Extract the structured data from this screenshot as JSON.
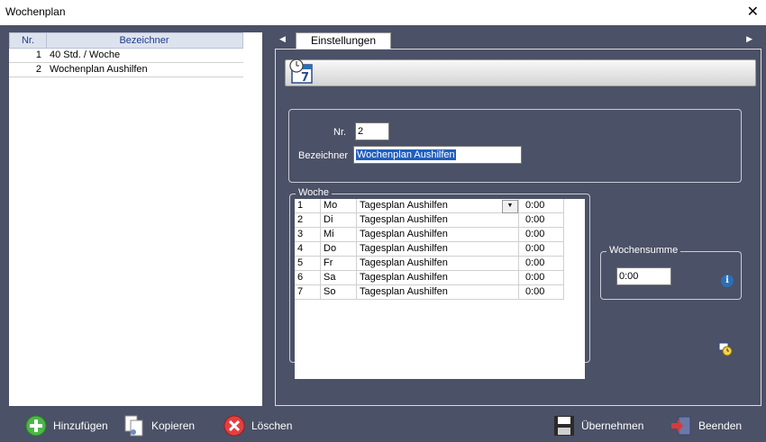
{
  "window": {
    "title": "Wochenplan"
  },
  "left_grid": {
    "headers": {
      "nr": "Nr.",
      "bezeichner": "Bezeichner"
    },
    "rows": [
      {
        "nr": "1",
        "bezeichner": "40 Std. / Woche"
      },
      {
        "nr": "2",
        "bezeichner": "Wochenplan Aushilfen"
      }
    ]
  },
  "tabs": {
    "active": "Einstellungen",
    "arrow_left": "◀",
    "arrow_right": "▶"
  },
  "form": {
    "nr_label": "Nr.",
    "nr_value": "2",
    "bezeichner_label": "Bezeichner",
    "bezeichner_value": "Wochenplan Aushilfen"
  },
  "woche": {
    "title": "Woche",
    "rows": [
      {
        "nr": "1",
        "day": "Mo",
        "plan": "Tagesplan Aushilfen",
        "time": "0:00"
      },
      {
        "nr": "2",
        "day": "Di",
        "plan": "Tagesplan Aushilfen",
        "time": "0:00"
      },
      {
        "nr": "3",
        "day": "Mi",
        "plan": "Tagesplan Aushilfen",
        "time": "0:00"
      },
      {
        "nr": "4",
        "day": "Do",
        "plan": "Tagesplan Aushilfen",
        "time": "0:00"
      },
      {
        "nr": "5",
        "day": "Fr",
        "plan": "Tagesplan Aushilfen",
        "time": "0:00"
      },
      {
        "nr": "6",
        "day": "Sa",
        "plan": "Tagesplan Aushilfen",
        "time": "0:00"
      },
      {
        "nr": "7",
        "day": "So",
        "plan": "Tagesplan Aushilfen",
        "time": "0:00"
      }
    ]
  },
  "wochensumme": {
    "title": "Wochensumme",
    "value": "0:00"
  },
  "buttons": {
    "add": "Hinzufügen",
    "copy": "Kopieren",
    "delete": "Löschen",
    "apply": "Übernehmen",
    "exit": "Beenden"
  },
  "colors": {
    "background": "#4b5166",
    "accent": "#1f5fbf"
  }
}
